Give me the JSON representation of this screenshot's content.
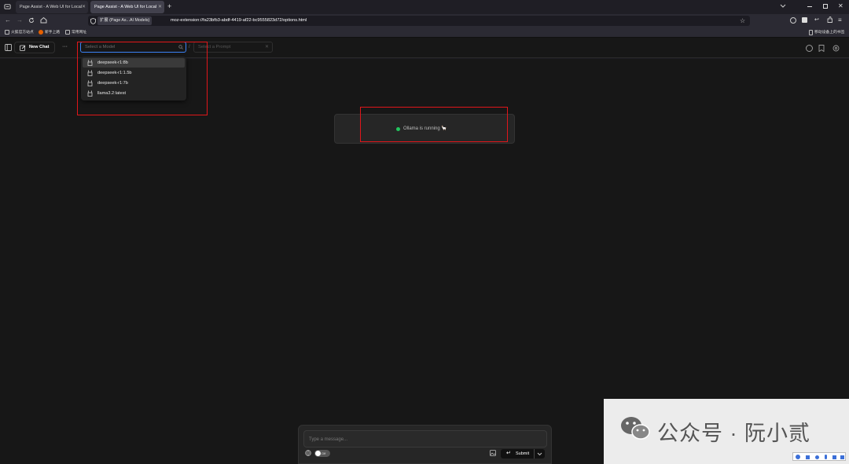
{
  "browser": {
    "tabs": [
      {
        "title": "Page Assist - A Web UI for Local"
      },
      {
        "title": "Page Assist - A Web UI for Local"
      }
    ],
    "new_tab": "+",
    "url_chip": "扩展 (Page As...AI Models)",
    "url": "moz-extension://fa23bfb3-abdf-4419-af22-bc9555823d72/options.html",
    "bookmarks": [
      "火狐官方站点",
      "新手上路",
      "常用网址"
    ],
    "bookmarks_right": "移动设备上的书签"
  },
  "app": {
    "new_chat_label": "New Chat",
    "more_label": "···",
    "model_select_placeholder": "Select a Model",
    "separator": "/",
    "prompt_select_placeholder": "Select a Prompt",
    "models": [
      "deepseek-r1:8b",
      "deepseek-r1:1.5b",
      "deepseek-r1:7b",
      "llama3.2:latest"
    ],
    "status_text": "Ollama is running 🦙",
    "composer": {
      "placeholder": "Type a message...",
      "toggle_label": "Off",
      "submit_label": "Submit"
    }
  },
  "watermark": {
    "text": "公众号 · 阮小贰"
  },
  "colors": {
    "accent": "#3b82f6",
    "status_green": "#22c55e",
    "annotation_red": "#e0161a"
  }
}
